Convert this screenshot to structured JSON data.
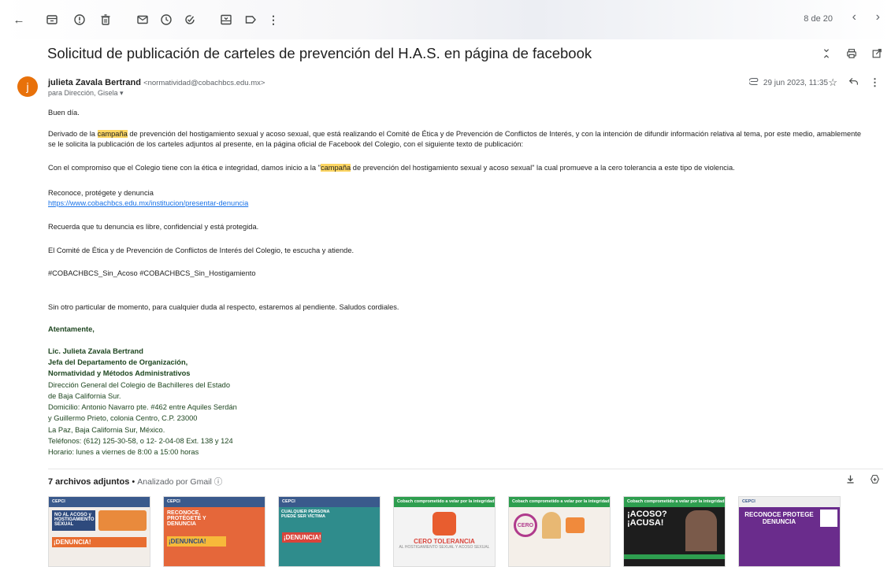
{
  "toolbar": {
    "back": "←",
    "archive": "archive-icon",
    "spam": "report-spam-icon",
    "delete": "trash-icon",
    "mark_unread": "mail-icon",
    "snooze": "clock-icon",
    "add_task": "add-task-icon",
    "move": "move-to-icon",
    "label": "label-icon",
    "more": "⋮",
    "pager": "8 de 20",
    "prev": "‹",
    "next": "›"
  },
  "email": {
    "subject": "Solicitud de publicación de carteles de prevención del H.A.S. en página de facebook",
    "avatar_letter": "j",
    "sender_name": "julieta Zavala Bertrand",
    "sender_email": "<normatividad@cobachbcs.edu.mx>",
    "to": "para Dirección, Gisela ▾",
    "date": "29 jun 2023, 11:35",
    "greeting": "Buen día.",
    "p1_a": "Derivado de la ",
    "p1_hl": "campaña",
    "p1_b": " de prevención del hostigamiento sexual y acoso sexual, que está realizando el Comité de Ética y de Prevención de Conflictos de Interés, y con la intención de difundir información relativa al tema, por este medio, amablemente se le solicita la publicación de los carteles adjuntos al presente, en la página oficial de Facebook del Colegio, con el siguiente texto de publicación:",
    "p2_a": "Con el compromiso que el Colegio tiene con la ética e integridad, damos inicio a la \"",
    "p2_hl": "campaña",
    "p2_b": " de prevención del hostigamiento sexual y acoso sexual\" la cual promueve a la cero tolerancia a este tipo de violencia.",
    "p3": "Reconoce, protégete y denuncia",
    "link": "https://www.cobachbcs.edu.mx/institucion/presentar-denuncia",
    "p4": "Recuerda que tu denuncia es libre, confidencial y está protegida.",
    "p5": "El Comité de Ética y de Prevención de Conflictos de Interés del Colegio, te escucha y atiende.",
    "p6": "#COBACHBCS_Sin_Acoso #COBACHBCS_Sin_Hostigamiento",
    "p7": "Sin otro particular de momento, para cualquier duda al respecto, estaremos al pendiente. Saludos cordiales.",
    "closing": "Atentamente,",
    "sig_name": "Lic. Julieta Zavala Bertrand",
    "sig_title1": "Jefa del Departamento de Organización,",
    "sig_title2": "Normatividad y Métodos Administrativos",
    "sig_l1": "Dirección General del Colegio de Bachilleres del Estado",
    "sig_l2": "de Baja California Sur.",
    "sig_l3": "Domicilio: Antonio Navarro pte. #462 entre Aquiles Serdán",
    "sig_l4": "y Guillermo Prieto, colonia Centro, C.P. 23000",
    "sig_l5": "La Paz, Baja California Sur, México.",
    "sig_l6": "Teléfonos: (612) 125-30-58, o 12- 2-04-08 Ext. 138 y 124",
    "sig_l7": "Horario: lunes a viernes de 8:00 a 15:00 horas"
  },
  "attachments": {
    "count_label": "7 archivos adjuntos",
    "separator": " • ",
    "scan_label": "Analizado por Gmail ⓘ",
    "thumbs": [
      {
        "header": "CEPCI",
        "big": "NO AL ACOSO y HOSTIGAMIENTO SEXUAL",
        "foot": "¡DENUNCIA!"
      },
      {
        "header": "CEPCI",
        "big": "RECONOCE, PROTÉGETE Y DENUNCIA",
        "foot": "¡DENUNCIA!"
      },
      {
        "header": "CEPCI",
        "big": "CUALQUIER PERSONA PUEDE SER VÍCTIMA",
        "foot": "¡DENUNCIA!"
      },
      {
        "header": "Cobach comprometido a velar por la integridad de todas y todos",
        "big": "CERO TOLERANCIA",
        "foot": "AL HOSTIGAMIENTO SEXUAL Y ACOSO SEXUAL"
      },
      {
        "header": "Cobach comprometido a velar por la integridad de todas y todos",
        "big": "CERO",
        "foot": ""
      },
      {
        "header": "Cobach comprometido a velar por la integridad de todas y todos",
        "big": "¡ACOSO? ¡ACUSA!",
        "foot": ""
      },
      {
        "header": "CEPCI",
        "big": "RECONOCE PROTEGE DENUNCIA",
        "foot": ""
      }
    ]
  }
}
